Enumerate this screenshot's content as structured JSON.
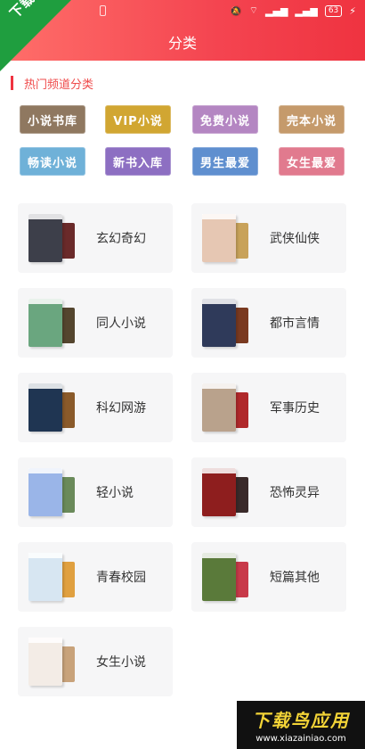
{
  "watermark": {
    "corner_text": "下载鸟",
    "brand": "下载鸟应用",
    "url": "www.xiazainiao.com"
  },
  "status_bar": {
    "battery": "63"
  },
  "header": {
    "title": "分类"
  },
  "section": {
    "title": "热门频道分类"
  },
  "tags": [
    {
      "label": "小说书库",
      "color": "#8f7860"
    },
    {
      "label": "VIP小说",
      "color": "#d1a632"
    },
    {
      "label": "免费小说",
      "color": "#b486c2"
    },
    {
      "label": "完本小说",
      "color": "#c59a6b"
    },
    {
      "label": "畅读小说",
      "color": "#6fb1d8"
    },
    {
      "label": "新书入库",
      "color": "#8d6fc2"
    },
    {
      "label": "男生最爱",
      "color": "#5f8fcf"
    },
    {
      "label": "女生最爱",
      "color": "#e17a8e"
    }
  ],
  "categories": [
    {
      "label": "玄幻奇幻",
      "cover": "#3d3f4a",
      "back": "#6a2a2a"
    },
    {
      "label": "武侠仙侠",
      "cover": "#e6c7b3",
      "back": "#c8a25a"
    },
    {
      "label": "同人小说",
      "cover": "#6aa67f",
      "back": "#54452e"
    },
    {
      "label": "都市言情",
      "cover": "#2f3a5a",
      "back": "#7a3a20"
    },
    {
      "label": "科幻网游",
      "cover": "#1f3552",
      "back": "#8a5a2a"
    },
    {
      "label": "军事历史",
      "cover": "#b9a28c",
      "back": "#b0282a"
    },
    {
      "label": "轻小说",
      "cover": "#9ab5e8",
      "back": "#6a8a5a"
    },
    {
      "label": "恐怖灵异",
      "cover": "#8e1e1e",
      "back": "#3a2a2a"
    },
    {
      "label": "青春校园",
      "cover": "#d7e6f2",
      "back": "#e0a040"
    },
    {
      "label": "短篇其他",
      "cover": "#5a7a3a",
      "back": "#c83a4a"
    },
    {
      "label": "女生小说",
      "cover": "#f3ece6",
      "back": "#c8a27a"
    }
  ]
}
